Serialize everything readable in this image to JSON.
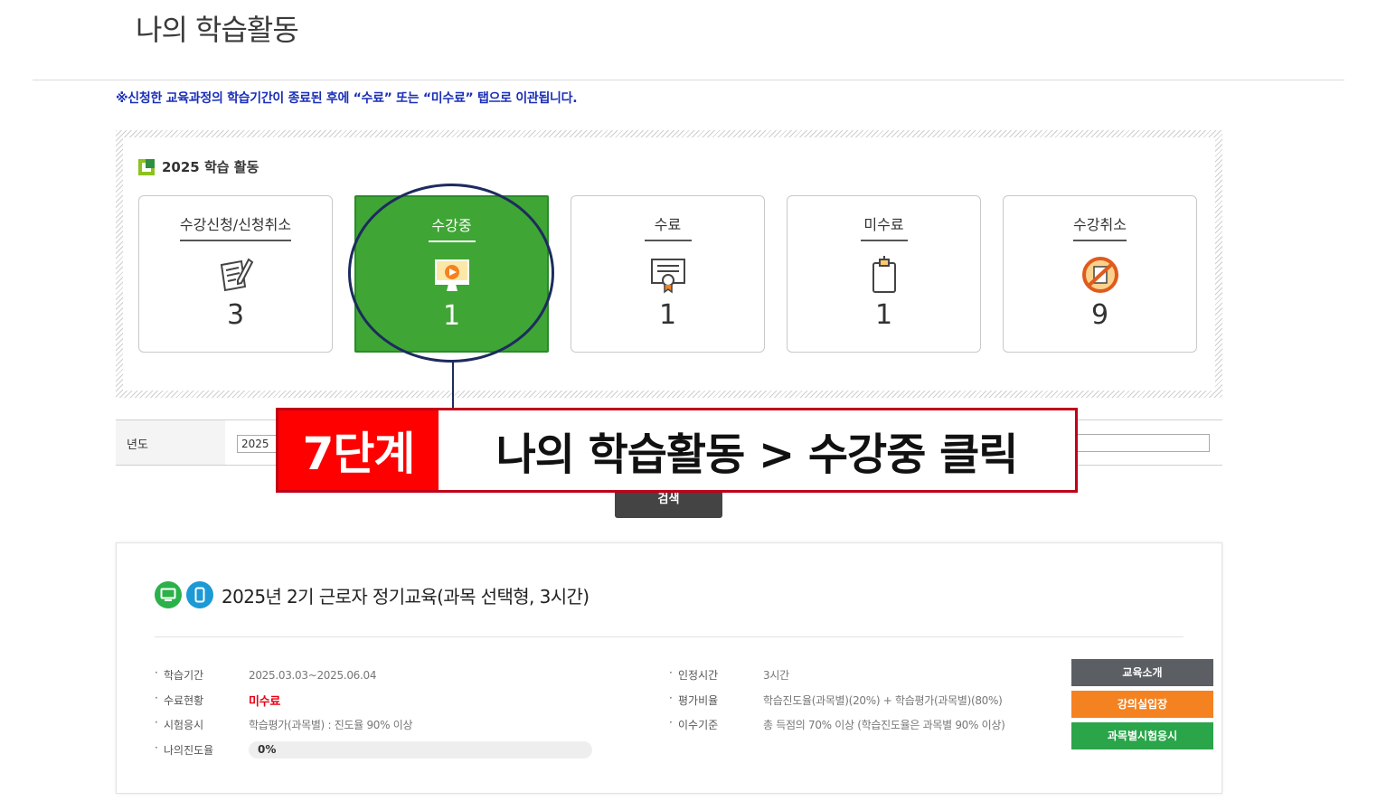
{
  "page": {
    "title": "나의 학습활동",
    "notice": "※신청한 교육과정의 학습기간이 종료된 후에 “수료” 또는 “미수료” 탭으로 이관됩니다."
  },
  "activity": {
    "heading": "2025 학습 활동",
    "cards": [
      {
        "label": "수강신청/신청취소",
        "count": "3",
        "icon": "document-pen-icon"
      },
      {
        "label": "수강중",
        "count": "1",
        "icon": "monitor-play-icon",
        "active": true
      },
      {
        "label": "수료",
        "count": "1",
        "icon": "certificate-icon"
      },
      {
        "label": "미수료",
        "count": "1",
        "icon": "clipboard-icon"
      },
      {
        "label": "수강취소",
        "count": "9",
        "icon": "cancel-icon"
      }
    ]
  },
  "search": {
    "year_label": "년도",
    "year_value": "2025",
    "button": "검색"
  },
  "step": {
    "tag": "7단계",
    "text": "나의 학습활동 > 수강중 클릭"
  },
  "course": {
    "title": "2025년 2기 근로자 정기교육(과목 선택형, 3시간)",
    "left": [
      {
        "key": "학습기간",
        "value": "2025.03.03~2025.06.04"
      },
      {
        "key": "수료현황",
        "value": "미수료"
      },
      {
        "key": "시험응시",
        "value": "학습평가(과목별) : 진도율 90% 이상"
      },
      {
        "key": "나의진도율",
        "value": "0%"
      }
    ],
    "right": [
      {
        "key": "인정시간",
        "value": "3시간"
      },
      {
        "key": "평가비율",
        "value": "학습진도율(과목별)(20%) + 학습평가(과목별)(80%)"
      },
      {
        "key": "이수기준",
        "value": "총 득점의 70% 이상 (학습진도율은 과목별 90% 이상)"
      }
    ],
    "progress_fraction": 0,
    "buttons": {
      "intro": "교육소개",
      "lecture": "강의실입장",
      "exam": "과목별시험응시"
    }
  },
  "colors": {
    "active_card": "#3fa535",
    "notice": "#1a2fb8",
    "step_tag": "#ff0000",
    "btn_intro": "#5b5e63",
    "btn_lecture": "#f58220",
    "btn_exam": "#2aa54a"
  }
}
